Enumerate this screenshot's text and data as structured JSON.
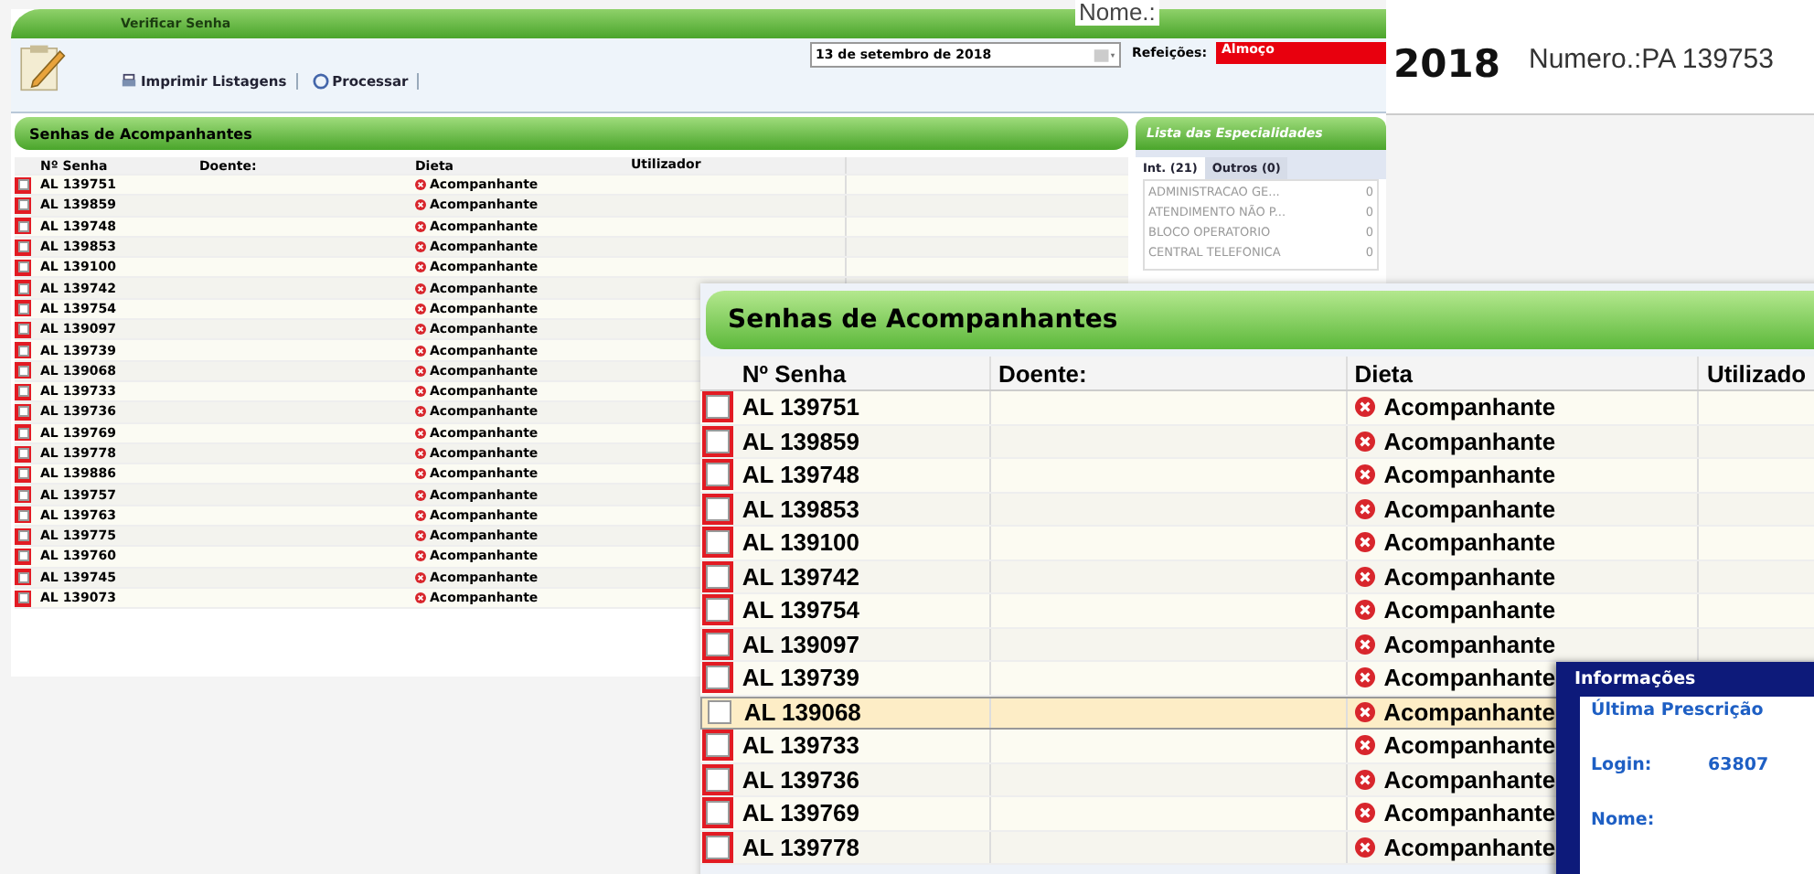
{
  "back_header": {
    "name_label": "Nome.:",
    "year": "2018",
    "number": "Numero.:PA 139753"
  },
  "window": {
    "title": "Verificar Senha",
    "toolbar": [
      {
        "label": "Imprimir Listagens",
        "kind": "print"
      },
      {
        "label": "Processar",
        "kind": "process"
      }
    ],
    "date": "13 de setembro de 2018",
    "meal_label": "Refeições:",
    "meal": "Almoço"
  },
  "small_table": {
    "title": "Senhas de Acompanhantes",
    "columns": [
      "Nº Senha",
      "Doente:",
      "Dieta",
      "Utilizador"
    ],
    "rows": [
      {
        "senha": "AL 139751",
        "dieta": "Acompanhante",
        "checked": false
      },
      {
        "senha": "AL 139859",
        "dieta": "Acompanhante",
        "checked": false
      },
      {
        "senha": "AL 139748",
        "dieta": "Acompanhante",
        "checked": false
      },
      {
        "senha": "AL 139853",
        "dieta": "Acompanhante",
        "checked": false
      },
      {
        "senha": "AL 139100",
        "dieta": "Acompanhante",
        "checked": false
      },
      {
        "senha": "AL 139742",
        "dieta": "Acompanhante",
        "checked": false
      },
      {
        "senha": "AL 139754",
        "dieta": "Acompanhante",
        "checked": false
      },
      {
        "senha": "AL 139097",
        "dieta": "Acompanhante",
        "checked": false
      },
      {
        "senha": "AL 139739",
        "dieta": "Acompanhante",
        "checked": false
      },
      {
        "senha": "AL 139068",
        "dieta": "Acompanhante",
        "checked": false
      },
      {
        "senha": "AL 139733",
        "dieta": "Acompanhante",
        "checked": false
      },
      {
        "senha": "AL 139736",
        "dieta": "Acompanhante",
        "checked": false
      },
      {
        "senha": "AL 139769",
        "dieta": "Acompanhante",
        "checked": false
      },
      {
        "senha": "AL 139778",
        "dieta": "Acompanhante",
        "checked": false
      },
      {
        "senha": "AL 139886",
        "dieta": "Acompanhante",
        "checked": false
      },
      {
        "senha": "AL 139757",
        "dieta": "Acompanhante",
        "checked": false
      },
      {
        "senha": "AL 139763",
        "dieta": "Acompanhante",
        "checked": false
      },
      {
        "senha": "AL 139775",
        "dieta": "Acompanhante",
        "checked": false
      },
      {
        "senha": "AL 139760",
        "dieta": "Acompanhante",
        "checked": false
      },
      {
        "senha": "AL 139745",
        "dieta": "Acompanhante",
        "checked": false
      },
      {
        "senha": "AL 139073",
        "dieta": "Acompanhante",
        "checked": false
      }
    ]
  },
  "specialties": {
    "title": "Lista das Especialidades",
    "tabs": [
      {
        "label": "Int. (21)",
        "selected": true
      },
      {
        "label": "Outros (0)",
        "selected": false
      }
    ],
    "items": [
      {
        "name": "ADMINISTRACAO GE...",
        "count": "0"
      },
      {
        "name": "ATENDIMENTO NÃO P...",
        "count": "0"
      },
      {
        "name": "BLOCO OPERATORIO",
        "count": "0"
      },
      {
        "name": "CENTRAL TELEFONICA",
        "count": "0"
      }
    ]
  },
  "zoomed_table": {
    "title": "Senhas de Acompanhantes",
    "columns": [
      "Nº Senha",
      "Doente:",
      "Dieta",
      "Utilizado"
    ],
    "rows": [
      {
        "senha": "AL 139751",
        "dieta": "Acompanhante",
        "selected": false,
        "checked": false
      },
      {
        "senha": "AL 139859",
        "dieta": "Acompanhante",
        "selected": false,
        "checked": false
      },
      {
        "senha": "AL 139748",
        "dieta": "Acompanhante",
        "selected": false,
        "checked": false
      },
      {
        "senha": "AL 139853",
        "dieta": "Acompanhante",
        "selected": false,
        "checked": false
      },
      {
        "senha": "AL 139100",
        "dieta": "Acompanhante",
        "selected": false,
        "checked": false
      },
      {
        "senha": "AL 139742",
        "dieta": "Acompanhante",
        "selected": false,
        "checked": false
      },
      {
        "senha": "AL 139754",
        "dieta": "Acompanhante",
        "selected": false,
        "checked": false
      },
      {
        "senha": "AL 139097",
        "dieta": "Acompanhante",
        "selected": false,
        "checked": false
      },
      {
        "senha": "AL 139739",
        "dieta": "Acompanhante",
        "selected": false,
        "checked": false
      },
      {
        "senha": "AL 139068",
        "dieta": "Acompanhante",
        "selected": true,
        "checked": false
      },
      {
        "senha": "AL 139733",
        "dieta": "Acompanhante",
        "selected": false,
        "checked": false
      },
      {
        "senha": "AL 139736",
        "dieta": "Acompanhante",
        "selected": false,
        "checked": false
      },
      {
        "senha": "AL 139769",
        "dieta": "Acompanhante",
        "selected": false,
        "checked": false
      },
      {
        "senha": "AL 139778",
        "dieta": "Acompanhante",
        "selected": false,
        "checked": false
      }
    ]
  },
  "info_popup": {
    "title": "Informações",
    "heading": "Última Prescrição",
    "fields": [
      {
        "label": "Login:",
        "value": "63807"
      },
      {
        "label": "Nome:"
      }
    ]
  }
}
